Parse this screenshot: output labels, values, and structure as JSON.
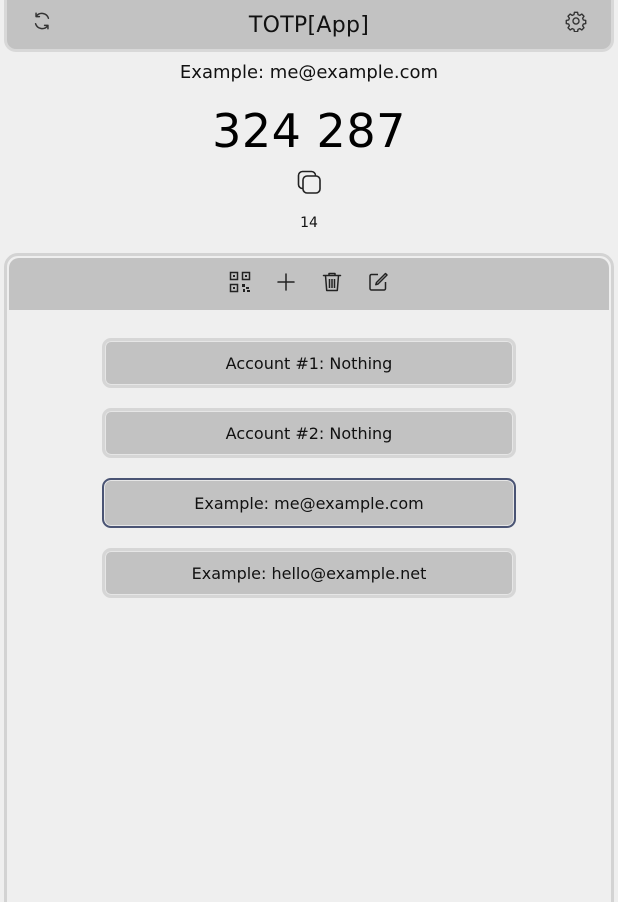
{
  "header": {
    "title": "TOTP[App]",
    "refresh_icon": "refresh-icon",
    "settings_icon": "gear-icon"
  },
  "current": {
    "account": "Example: me@example.com",
    "code": "324 287",
    "countdown": "14",
    "copy_icon": "copy-icon"
  },
  "toolbar": {
    "icons": [
      "qr-code-icon",
      "plus-icon",
      "trash-icon",
      "edit-icon"
    ]
  },
  "accounts": [
    {
      "label": "Account #1: Nothing"
    },
    {
      "label": "Account #2: Nothing"
    },
    {
      "label": "Example: me@example.com",
      "selected": true
    },
    {
      "label": "Example: hello@example.net"
    }
  ],
  "colors": {
    "background": "#efefef",
    "bar": "#c2c2c2",
    "selected_border": "#4a5474"
  }
}
